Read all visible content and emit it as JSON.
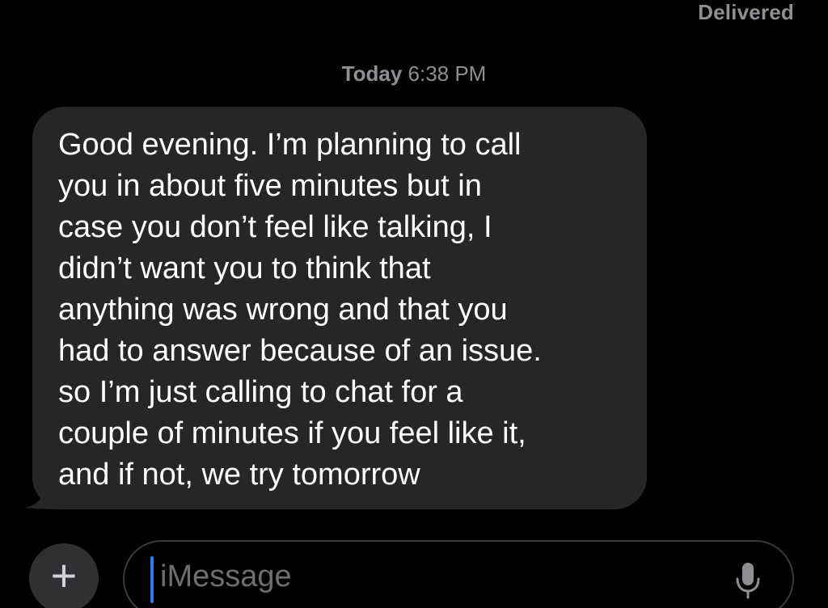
{
  "status": {
    "delivered": "Delivered"
  },
  "timestamp": {
    "day": "Today",
    "time": "6:38 PM"
  },
  "messages": [
    {
      "direction": "incoming",
      "text": "Good evening. I’m planning to call\nyou in about five minutes but in\ncase you don’t feel like talking, I\ndidn’t want you to think that\nanything was wrong and that you\nhad to answer because of an issue.\nso I’m just calling to chat for a\ncouple of minutes if you feel like it,\nand if not, we try tomorrow"
    }
  ],
  "composer": {
    "add_label": "+",
    "placeholder": "iMessage",
    "add_icon": "plus-icon",
    "mic_icon": "microphone-icon"
  },
  "colors": {
    "background": "#000000",
    "bubble": "#262628",
    "secondary_text": "#8e8e93",
    "caret": "#3478f6"
  }
}
